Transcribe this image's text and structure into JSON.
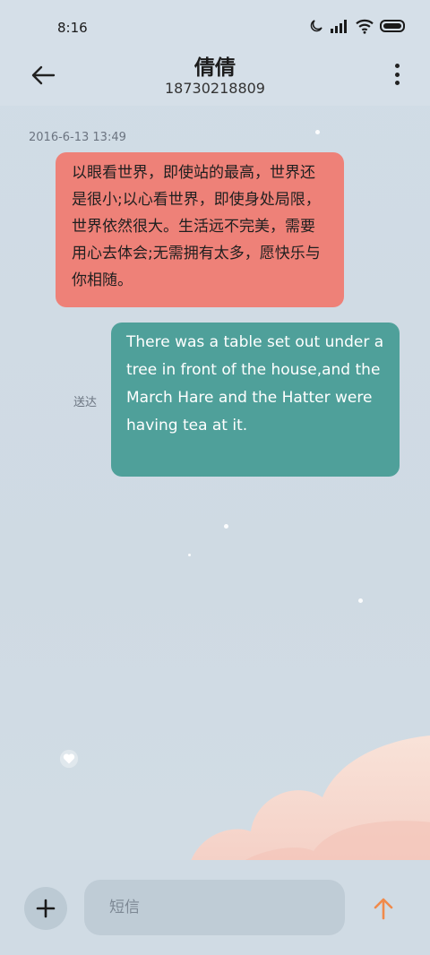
{
  "status_bar": {
    "time": "8:16",
    "icons": [
      "moon-icon",
      "signal-icon",
      "wifi-icon",
      "battery-icon"
    ]
  },
  "header": {
    "contact_name": "倩倩",
    "contact_number": "18730218809",
    "icons": [
      "back-arrow-icon",
      "more-vertical-icon"
    ]
  },
  "conversation": {
    "timestamp": "2016-6-13 13:49",
    "messages": [
      {
        "direction": "incoming",
        "text": "以眼看世界，即使站的最高，世界还是很小;以心看世界，即使身处局限，世界依然很大。生活远不完美，需要用心去体会;无需拥有太多，愿快乐与你相随。",
        "color": "#ee8178"
      },
      {
        "direction": "outgoing",
        "text": "There was a table set out under a tree in front of the house,and the March Hare and the Hatter were having tea at it.",
        "status": "送达",
        "color": "#4fa09a"
      }
    ]
  },
  "composer": {
    "placeholder": "短信",
    "value": "",
    "icons": [
      "plus-icon",
      "send-arrow-icon"
    ],
    "send_color": "#f08a4b"
  }
}
